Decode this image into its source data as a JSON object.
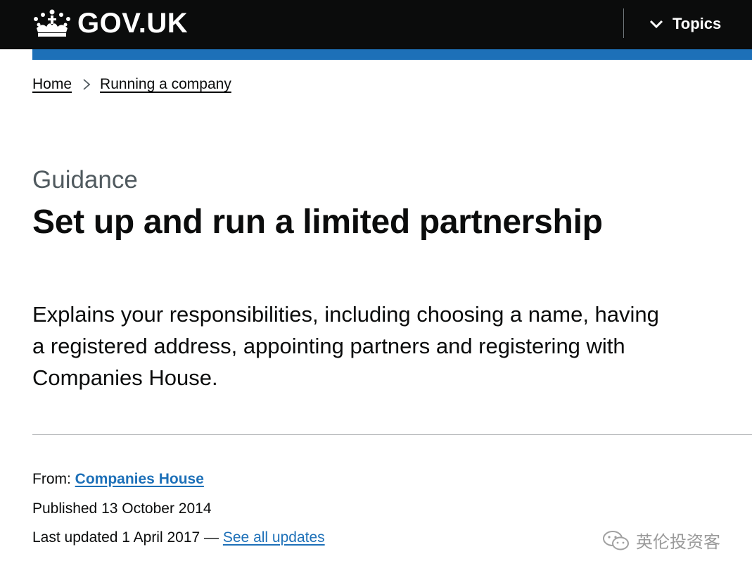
{
  "header": {
    "logo_text": "GOV.UK",
    "topics_label": "Topics"
  },
  "breadcrumb": {
    "items": [
      "Home",
      "Running a company"
    ]
  },
  "page": {
    "caption": "Guidance",
    "title": "Set up and run a limited partnership",
    "lead": "Explains your responsibilities, including choosing a name, having a registered address, appointing partners and registering with Companies House."
  },
  "meta": {
    "from_label": "From:",
    "from_org": "Companies House",
    "published": "Published 13 October 2014",
    "last_updated": "Last updated 1 April 2017 —",
    "see_all_updates": "See all updates"
  },
  "watermark": {
    "text": "英伦投资客"
  },
  "colors": {
    "header_bg": "#0b0c0c",
    "accent_blue": "#1d70b8",
    "caption_grey": "#505a5f"
  },
  "icons": [
    "crown-icon",
    "chevron-down-icon",
    "chevron-right-icon",
    "wechat-icon"
  ]
}
